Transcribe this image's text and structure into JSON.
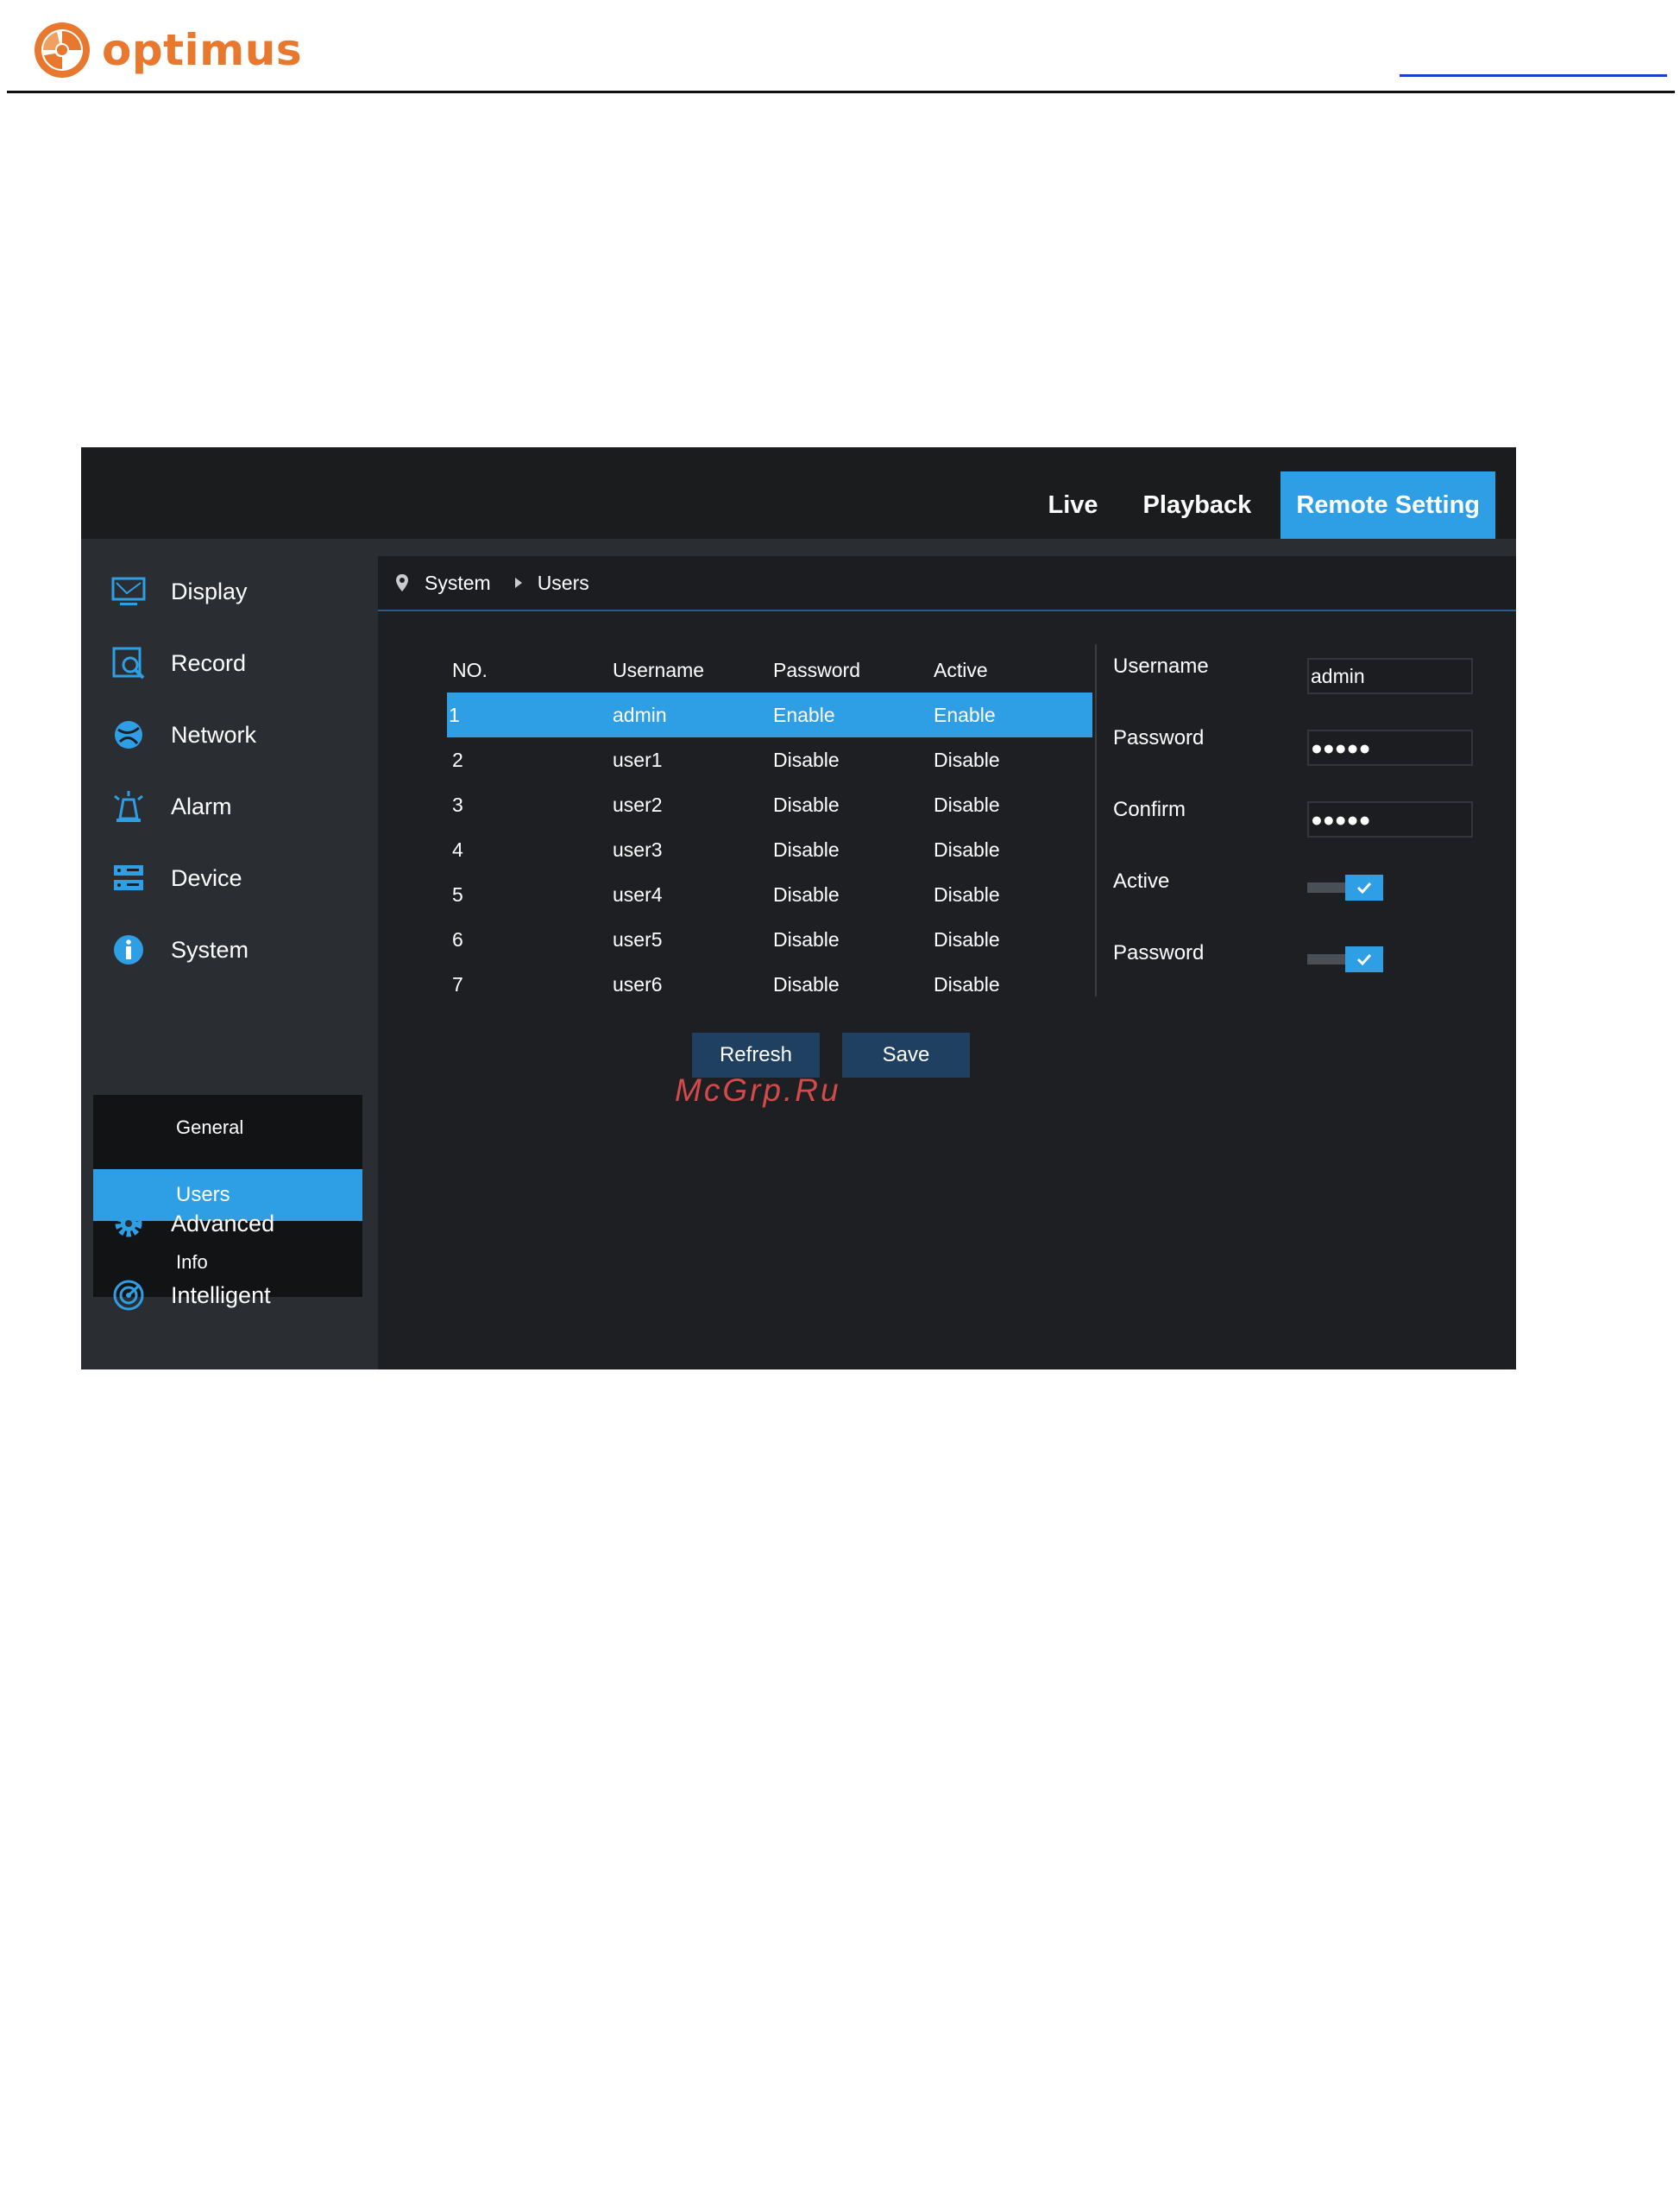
{
  "document": {
    "brand": "optimus",
    "brand_color": "#e8782e"
  },
  "app": {
    "accent": "#2f9fe5",
    "topnav": [
      {
        "label": "Live",
        "active": false
      },
      {
        "label": "Playback",
        "active": false
      },
      {
        "label": "Remote Setting",
        "active": true
      }
    ],
    "sidebar": {
      "items": [
        {
          "label": "Display",
          "icon": "monitor-icon"
        },
        {
          "label": "Record",
          "icon": "record-icon"
        },
        {
          "label": "Network",
          "icon": "globe-icon"
        },
        {
          "label": "Alarm",
          "icon": "alarm-icon"
        },
        {
          "label": "Device",
          "icon": "device-icon"
        },
        {
          "label": "System",
          "icon": "info-icon"
        },
        {
          "label": "Advanced",
          "icon": "gear-icon"
        },
        {
          "label": "Intelligent",
          "icon": "radar-icon"
        }
      ],
      "submenu": [
        {
          "label": "General",
          "active": false
        },
        {
          "label": "Users",
          "active": true
        },
        {
          "label": "Info",
          "active": false
        }
      ]
    },
    "breadcrumb": [
      "System",
      "Users"
    ],
    "table": {
      "headers": [
        "NO.",
        "Username",
        "Password",
        "Active"
      ],
      "rows": [
        [
          "1",
          "admin",
          "Enable",
          "Enable"
        ],
        [
          "2",
          "user1",
          "Disable",
          "Disable"
        ],
        [
          "3",
          "user2",
          "Disable",
          "Disable"
        ],
        [
          "4",
          "user3",
          "Disable",
          "Disable"
        ],
        [
          "5",
          "user4",
          "Disable",
          "Disable"
        ],
        [
          "6",
          "user5",
          "Disable",
          "Disable"
        ],
        [
          "7",
          "user6",
          "Disable",
          "Disable"
        ]
      ],
      "selected_row": 0
    },
    "form": {
      "username_label": "Username",
      "username_value": "admin",
      "password_label": "Password",
      "password_value": "●●●●●",
      "confirm_label": "Confirm",
      "confirm_value": "●●●●●",
      "active_label": "Active",
      "active_checked": true,
      "password_toggle_label": "Password",
      "password_toggle_checked": true
    },
    "buttons": {
      "refresh": "Refresh",
      "save": "Save"
    }
  },
  "watermark": "McGrp.Ru"
}
